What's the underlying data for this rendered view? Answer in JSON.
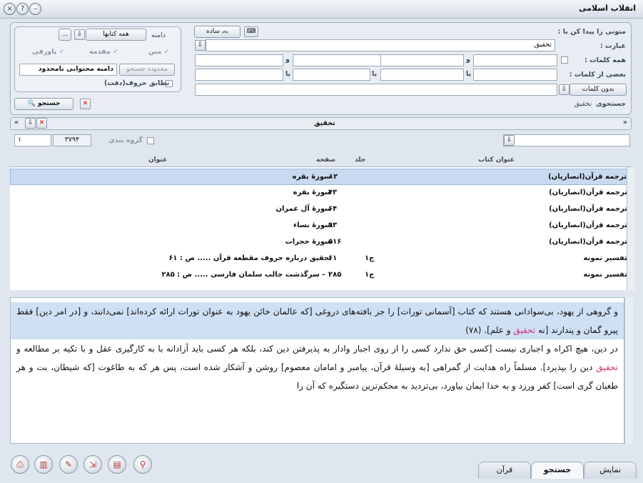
{
  "window": {
    "title": "انقلاب اسلامی",
    "buttons": [
      "×",
      "?",
      "–"
    ]
  },
  "search": {
    "heading": "متونی را پیدا کن با :",
    "phrase_label": "عبارت :",
    "phrase_value": "تحقیق",
    "all_words_label": "همه کلمات :",
    "and_word": "و",
    "some_words_label": "بعضی از کلمات :",
    "or_word": "یا",
    "without_label": "بدون کلمات",
    "simple_button": "ساده",
    "domain_label": "دامنه",
    "domain_value": "همه کتابها",
    "more": "...",
    "opt_text": "متن",
    "opt_intro": "مقدمه",
    "opt_footnote": "پاورقی",
    "limit_button": "محدوده جستجو",
    "limit_value": "دامنه محتوایی نامحدود",
    "exact_match": "تطابق حروف(دقت)",
    "search_button": "جستجو",
    "history_label": "جستجوی",
    "history_value": "تحقیق"
  },
  "results": {
    "header_title": "تحقیق",
    "count": "۳۷۹۴",
    "page": "۱",
    "grouping": "گروه بندی",
    "columns": {
      "book": "عنوان کتاب",
      "volume": "جلد",
      "page": "صفحه",
      "title": "عنوان"
    },
    "rows": [
      {
        "book": "ترجمه قرآن(انصاریان)",
        "volume": "",
        "page": "۱۲",
        "title": "سورهٔ بقره"
      },
      {
        "book": "ترجمه قرآن(انصاریان)",
        "volume": "",
        "page": "۴۳",
        "title": "سورهٔ بقره"
      },
      {
        "book": "ترجمه قرآن(انصاریان)",
        "volume": "",
        "page": "۶۴",
        "title": "سورهٔ آل عمران"
      },
      {
        "book": "ترجمه قرآن(انصاریان)",
        "volume": "",
        "page": "۹۳",
        "title": "سورهٔ نساء"
      },
      {
        "book": "ترجمه قرآن(انصاریان)",
        "volume": "",
        "page": "۵۱۶",
        "title": "سورهٔ حجرات"
      },
      {
        "book": "تفسیر نمونه",
        "volume": "ج۱",
        "page": "۶۱",
        "title": "تحقیق درباره حروف مقطعه قرآن ..... ص : ۶۱"
      },
      {
        "book": "تفسیر نمونه",
        "volume": "ج۱",
        "page": "۲۸۵",
        "title": "۱ - سرگذشت جالب سلمان فارسی ..... ص : ۲۸۵"
      }
    ]
  },
  "text": {
    "p1_a": "و گروهی از یهود، بی‌سوادانی هستند که کتاب [آسمانی تورات] را جز بافته‌های دروغی [که عالمان خائن یهود به عنوان تورات ارائه کرده‌اند] نمی‌دانند، و [در امر دین] فقط پیرو گمان و پندارند [نه ",
    "p1_hl": "تحقیق",
    "p1_b": " و علم]. (۷۸)",
    "p2_a": "در دین، هیچ اکراه و اجباری نیست [کسی حق ندارد کسی را از روی اجبار وادار به پذیرفتن دین کند، بلکه هر کسی باید آزادانه با به کارگیری عقل و با تکیه بر مطالعه و ",
    "p2_hl": "تحقیق",
    "p2_b": " دین را بپذیرد]. مسلماً راه هدایت از گمراهی [به وسیلهٔ قرآن، پیامبر و امامان معصوم] روشن و آشکار شده است، پس هر که به طاغوت [که شیطان، بت و هر طغیان گری است] کفر ورزد و به خدا ایمان بیاورد، بی‌تردید به محکم‌ترین دستگیره که آن را"
  },
  "tabs": {
    "show": "نمایش",
    "search": "جستجو",
    "quran": "قرآن"
  }
}
